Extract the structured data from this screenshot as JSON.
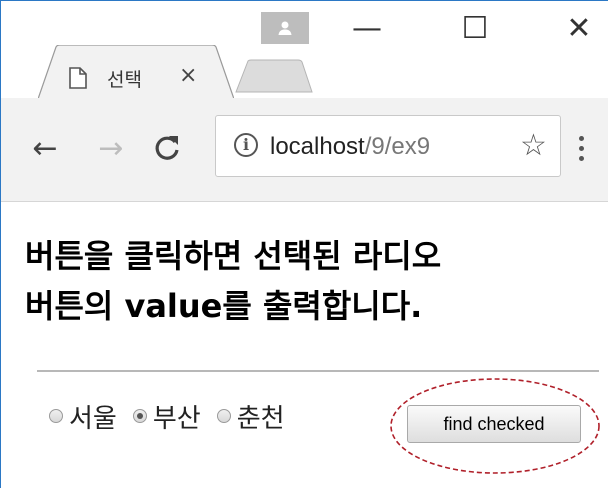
{
  "browser": {
    "tab": {
      "title": "선택",
      "close_glyph": "×",
      "icon": "page-icon"
    },
    "window_buttons": {
      "minimize": "—",
      "maximize": "☐",
      "close": "✕"
    },
    "toolbar": {
      "back_glyph": "←",
      "forward_glyph": "→",
      "reload_glyph": "C",
      "url_host": "localhost",
      "url_path": "/9/ex9",
      "star_glyph": "☆",
      "info_glyph": "i"
    }
  },
  "page": {
    "heading_line1": "버튼을 클릭하면 선택된 라디오",
    "heading_line2": "버튼의 value를 출력합니다.",
    "radios": [
      {
        "label": "서울",
        "checked": false
      },
      {
        "label": "부산",
        "checked": true
      },
      {
        "label": "춘천",
        "checked": false
      }
    ],
    "button_label": "find checked"
  },
  "colors": {
    "window_border": "#2b78c5",
    "toolbar_bg": "#f2f2f2",
    "callout": "#b0202a"
  }
}
